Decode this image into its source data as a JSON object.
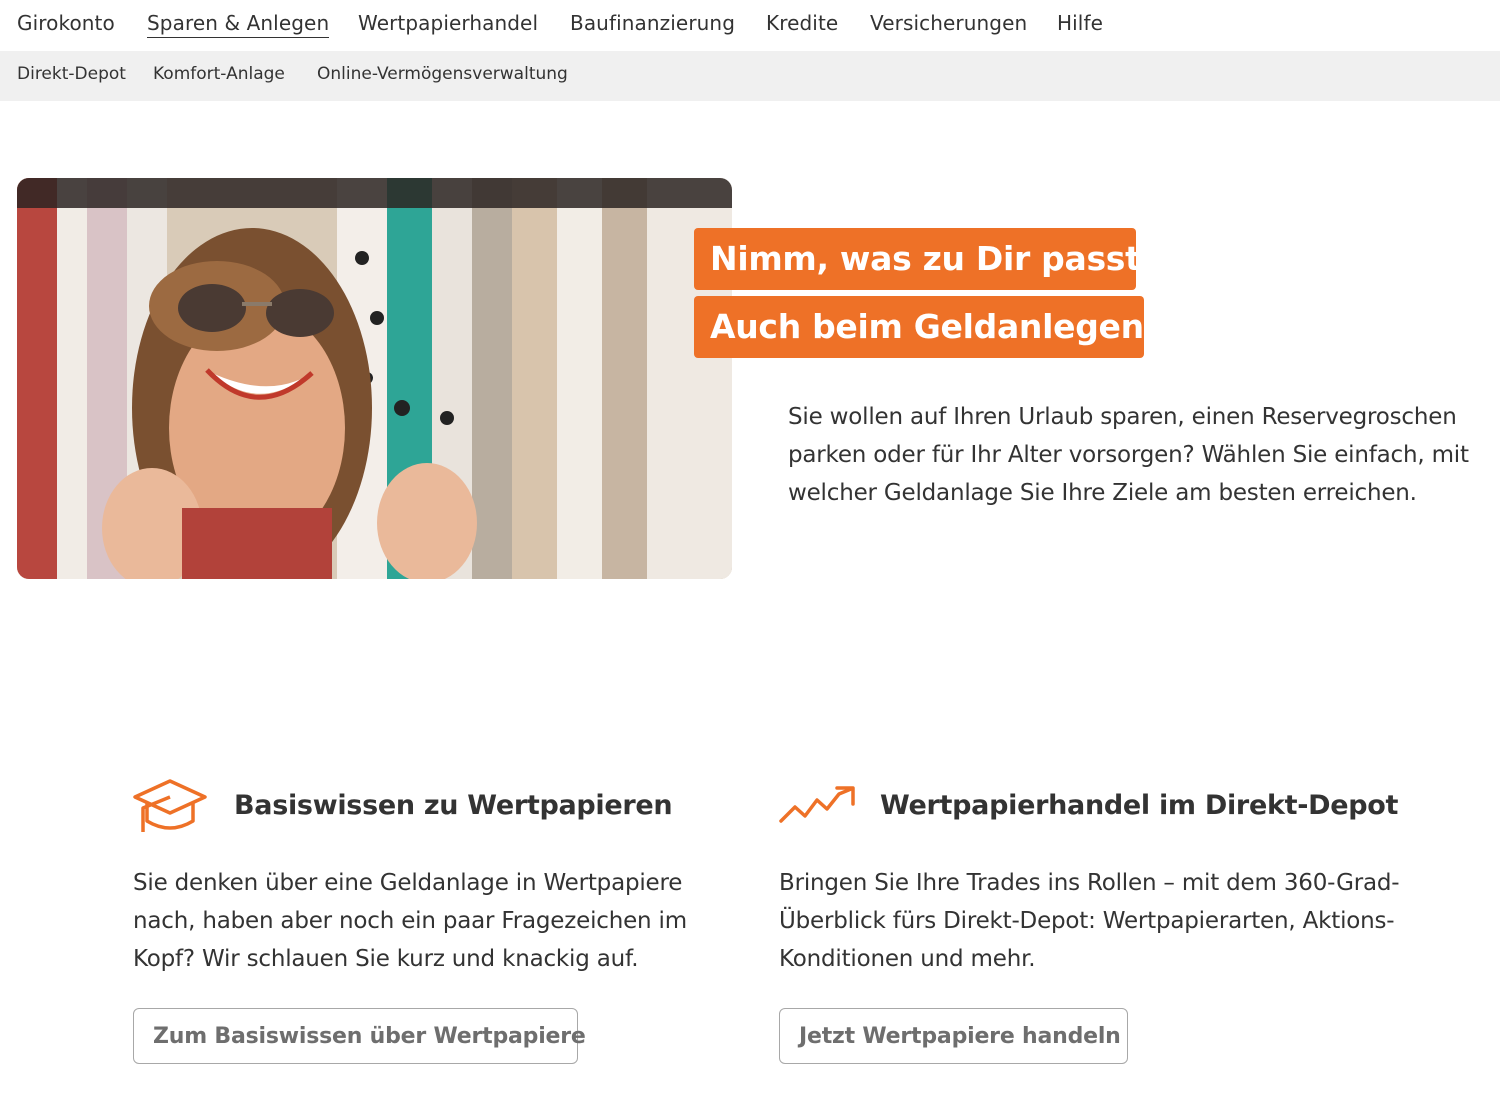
{
  "topnav": {
    "items": [
      {
        "label": "Girokonto"
      },
      {
        "label": "Sparen & Anlegen"
      },
      {
        "label": "Wertpapierhandel"
      },
      {
        "label": "Baufinanzierung"
      },
      {
        "label": "Kredite"
      },
      {
        "label": "Versicherungen"
      },
      {
        "label": "Hilfe"
      }
    ],
    "active": "Sparen & Anlegen"
  },
  "subnav": {
    "items": [
      {
        "label": "Direkt-Depot"
      },
      {
        "label": "Komfort-Anlage"
      },
      {
        "label": "Online-Vermögensverwaltung"
      }
    ]
  },
  "hero": {
    "headline_line1": "Nimm, was zu Dir passt.",
    "headline_line2": "Auch beim Geldanlegen.",
    "text": "Sie wollen auf Ihren Urlaub sparen, einen Reservegroschen parken oder für Ihr Alter vorsorgen? Wählen Sie einfach, mit welcher Geldanlage Sie Ihre Ziele am besten erreichen.",
    "image": "woman-with-sunglasses-among-clothes-rack"
  },
  "features": [
    {
      "icon": "graduation-cap-icon",
      "title": "Basiswissen zu Wertpapieren",
      "text": "Sie denken über eine Geldanlage in Wertpapiere nach, haben aber noch ein paar Fragezeichen im Kopf? Wir schlauen Sie kurz und knackig auf.",
      "button": "Zum Basiswissen über Wertpapiere"
    },
    {
      "icon": "trend-up-icon",
      "title": "Wertpapierhandel im Direkt-Depot",
      "text": "Bringen Sie Ihre Trades ins Rollen – mit dem 360-Grad-Überblick fürs Direkt-Depot: Wertpapierarten, Aktions-Konditionen und mehr.",
      "button": "Jetzt Wertpapiere handeln"
    }
  ],
  "colors": {
    "accent": "#ee7127",
    "text": "#333333",
    "subnav_bg": "#f0f0f0",
    "button_border": "#a8a8a8"
  }
}
